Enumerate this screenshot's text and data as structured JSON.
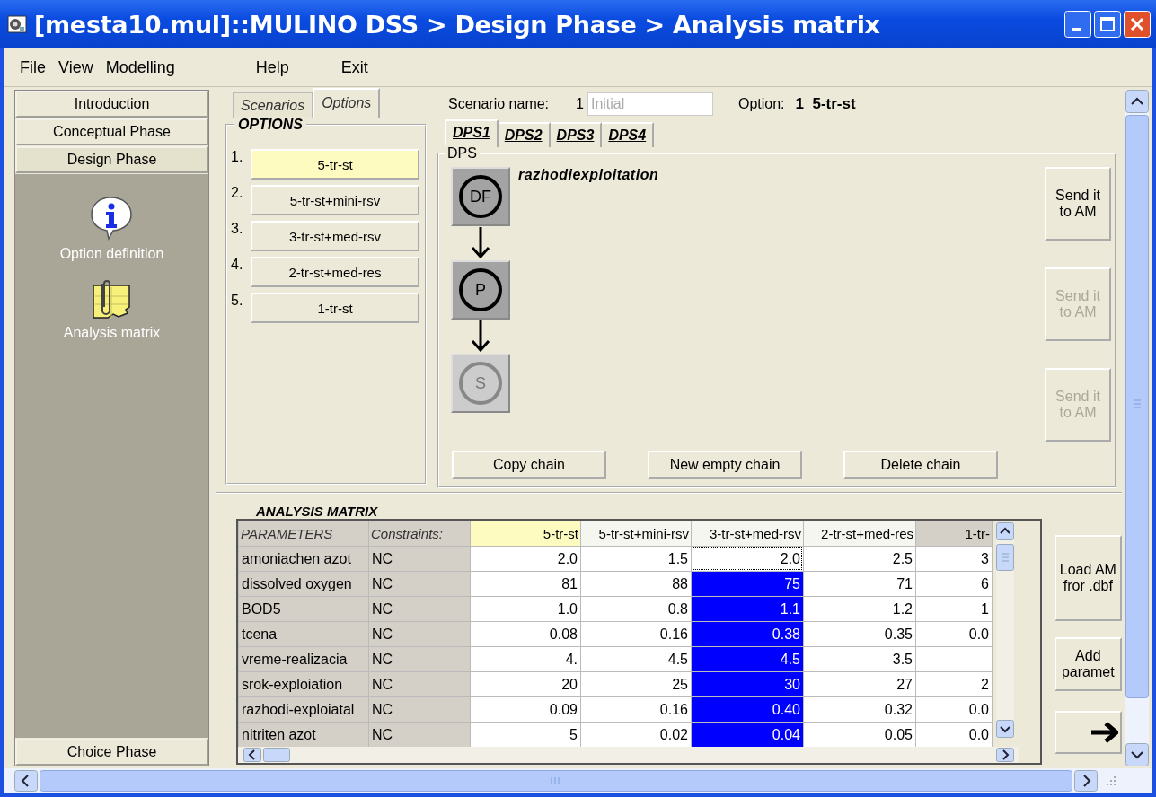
{
  "window": {
    "title": "[mesta10.mul]::MULINO DSS > Design Phase > Analysis matrix"
  },
  "menu": [
    "File",
    "View",
    "Modelling",
    "Help",
    "Exit"
  ],
  "sidebar": {
    "phases": [
      {
        "label": "Introduction",
        "selected": false
      },
      {
        "label": "Conceptual Phase",
        "selected": false
      },
      {
        "label": "Design Phase",
        "selected": true
      }
    ],
    "items": [
      {
        "kind": "info",
        "label": "Option definition"
      },
      {
        "kind": "matrix",
        "label": "Analysis matrix"
      }
    ],
    "bottom_phase": "Choice Phase"
  },
  "left_tabs": [
    {
      "label": "Scenarios",
      "selected": false
    },
    {
      "label": "Options",
      "selected": true
    }
  ],
  "options": {
    "title": "OPTIONS",
    "items": [
      {
        "number": "1.",
        "label": "5-tr-st",
        "selected": true
      },
      {
        "number": "2.",
        "label": "5-tr-st+mini-rsv",
        "selected": false
      },
      {
        "number": "3.",
        "label": "3-tr-st+med-rsv",
        "selected": false
      },
      {
        "number": "4.",
        "label": "2-tr-st+med-res",
        "selected": false
      },
      {
        "number": "5.",
        "label": "1-tr-st",
        "selected": false
      }
    ]
  },
  "scenario": {
    "label": "Scenario name:",
    "number": "1",
    "value": "Initial",
    "option_label": "Option:",
    "option_value": "1  5-tr-st"
  },
  "dps_tabs": [
    {
      "label": "DPS1",
      "selected": true
    },
    {
      "label": "DPS2",
      "selected": false
    },
    {
      "label": "DPS3",
      "selected": false
    },
    {
      "label": "DPS4",
      "selected": false
    }
  ],
  "dps": {
    "title": "DPS",
    "chain_name": "razhodiexploitation",
    "nodes": [
      {
        "label": "DF",
        "disabled": false
      },
      {
        "label": "P",
        "disabled": false
      },
      {
        "label": "S",
        "disabled": true
      }
    ],
    "send_buttons": [
      {
        "label": "Send it to AM",
        "disabled": false
      },
      {
        "label": "Send it to AM",
        "disabled": true
      },
      {
        "label": "Send it to AM",
        "disabled": true
      }
    ],
    "buttons": [
      "Copy chain",
      "New empty chain",
      "Delete chain"
    ]
  },
  "matrix": {
    "title": "ANALYSIS MATRIX",
    "columns": [
      {
        "label": "PARAMETERS",
        "kind": "fixed",
        "selected": false
      },
      {
        "label": "Constraints:",
        "kind": "fixed",
        "selected": false
      },
      {
        "label": "5-tr-st",
        "kind": "value",
        "selected": true
      },
      {
        "label": "5-tr-st+mini-rsv",
        "kind": "value",
        "selected": false
      },
      {
        "label": "3-tr-st+med-rsv",
        "kind": "value",
        "selected": false
      },
      {
        "label": "2-tr-st+med-res",
        "kind": "value",
        "selected": false
      },
      {
        "label": "1-tr-",
        "kind": "value",
        "selected": false
      }
    ],
    "rows": [
      {
        "cells": [
          {
            "text": "amoniachen azot",
            "selected": false,
            "focused": false
          },
          {
            "text": "NC",
            "selected": false,
            "focused": false
          },
          {
            "text": "2.0",
            "selected": false,
            "focused": false
          },
          {
            "text": "1.5",
            "selected": false,
            "focused": false
          },
          {
            "text": "2.0",
            "selected": false,
            "focused": true
          },
          {
            "text": "2.5",
            "selected": false,
            "focused": false
          },
          {
            "text": "3",
            "selected": false,
            "focused": false
          }
        ]
      },
      {
        "cells": [
          {
            "text": "dissolved oxygen",
            "selected": false,
            "focused": false
          },
          {
            "text": "NC",
            "selected": false,
            "focused": false
          },
          {
            "text": "81",
            "selected": false,
            "focused": false
          },
          {
            "text": "88",
            "selected": false,
            "focused": false
          },
          {
            "text": "75",
            "selected": true,
            "focused": false
          },
          {
            "text": "71",
            "selected": false,
            "focused": false
          },
          {
            "text": "6",
            "selected": false,
            "focused": false
          }
        ]
      },
      {
        "cells": [
          {
            "text": "BOD5",
            "selected": false,
            "focused": false
          },
          {
            "text": "NC",
            "selected": false,
            "focused": false
          },
          {
            "text": "1.0",
            "selected": false,
            "focused": false
          },
          {
            "text": "0.8",
            "selected": false,
            "focused": false
          },
          {
            "text": "1.1",
            "selected": true,
            "focused": false
          },
          {
            "text": "1.2",
            "selected": false,
            "focused": false
          },
          {
            "text": "1",
            "selected": false,
            "focused": false
          }
        ]
      },
      {
        "cells": [
          {
            "text": "tcena",
            "selected": false,
            "focused": false
          },
          {
            "text": "NC",
            "selected": false,
            "focused": false
          },
          {
            "text": "0.08",
            "selected": false,
            "focused": false
          },
          {
            "text": "0.16",
            "selected": false,
            "focused": false
          },
          {
            "text": "0.38",
            "selected": true,
            "focused": false
          },
          {
            "text": "0.35",
            "selected": false,
            "focused": false
          },
          {
            "text": "0.0",
            "selected": false,
            "focused": false
          }
        ]
      },
      {
        "cells": [
          {
            "text": "vreme-realizacia",
            "selected": false,
            "focused": false
          },
          {
            "text": "NC",
            "selected": false,
            "focused": false
          },
          {
            "text": "4.",
            "selected": false,
            "focused": false
          },
          {
            "text": "4.5",
            "selected": false,
            "focused": false
          },
          {
            "text": "4.5",
            "selected": true,
            "focused": false
          },
          {
            "text": "3.5",
            "selected": false,
            "focused": false
          },
          {
            "text": null,
            "selected": false,
            "focused": false
          }
        ]
      },
      {
        "cells": [
          {
            "text": "srok-exploiation",
            "selected": false,
            "focused": false
          },
          {
            "text": "NC",
            "selected": false,
            "focused": false
          },
          {
            "text": "20",
            "selected": false,
            "focused": false
          },
          {
            "text": "25",
            "selected": false,
            "focused": false
          },
          {
            "text": "30",
            "selected": true,
            "focused": false
          },
          {
            "text": "27",
            "selected": false,
            "focused": false
          },
          {
            "text": "2",
            "selected": false,
            "focused": false
          }
        ]
      },
      {
        "cells": [
          {
            "text": "razhodi-exploiatal",
            "selected": false,
            "focused": false
          },
          {
            "text": "NC",
            "selected": false,
            "focused": false
          },
          {
            "text": "0.09",
            "selected": false,
            "focused": false
          },
          {
            "text": "0.16",
            "selected": false,
            "focused": false
          },
          {
            "text": "0.40",
            "selected": true,
            "focused": false
          },
          {
            "text": "0.32",
            "selected": false,
            "focused": false
          },
          {
            "text": "0.0",
            "selected": false,
            "focused": false
          }
        ]
      },
      {
        "cells": [
          {
            "text": "nitriten azot",
            "selected": false,
            "focused": false
          },
          {
            "text": "NC",
            "selected": false,
            "focused": false
          },
          {
            "text": "5",
            "selected": false,
            "focused": false
          },
          {
            "text": "0.02",
            "selected": false,
            "focused": false
          },
          {
            "text": "0.04",
            "selected": true,
            "focused": false
          },
          {
            "text": "0.05",
            "selected": false,
            "focused": false
          },
          {
            "text": "0.0",
            "selected": false,
            "focused": false
          }
        ]
      }
    ],
    "side_buttons": [
      {
        "kind": "text",
        "label": "Load AM fror .dbf"
      },
      {
        "kind": "text",
        "label": "Add paramet"
      },
      {
        "kind": "arrow"
      }
    ]
  }
}
